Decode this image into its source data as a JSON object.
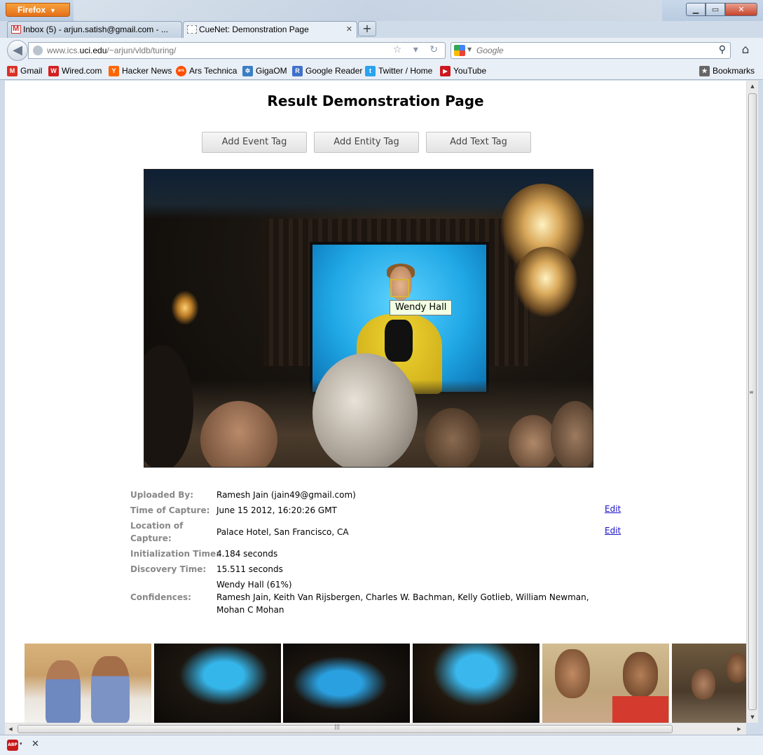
{
  "window": {
    "firefox_button_label": "Firefox",
    "min_glyph": "▁",
    "max_glyph": "▭",
    "close_glyph": "✕"
  },
  "tabs": [
    {
      "label": "Inbox (5) - arjun.satish@gmail.com - ...",
      "icon": "gmail-icon",
      "active": false
    },
    {
      "label": "CueNet: Demonstration Page",
      "icon": "blank-page-icon",
      "active": true
    }
  ],
  "newtab_glyph": "+",
  "navbar": {
    "back_glyph": "◀",
    "url_prefix": "www.ics.",
    "url_domain": "uci.edu",
    "url_suffix": "/~arjun/vldb/turing/",
    "url_buttons": "☆ ▾ ↻",
    "search_placeholder": "Google",
    "search_glyph": "⚲",
    "home_glyph": "⌂"
  },
  "bookmarks": [
    {
      "label": "Gmail",
      "icon": "gmail-icon",
      "color": "#d93025",
      "glyph": "M"
    },
    {
      "label": "Wired.com",
      "icon": "wired-icon",
      "color": "#d32020",
      "glyph": "W"
    },
    {
      "label": "Hacker News",
      "icon": "hacker-news-icon",
      "color": "#ff6600",
      "glyph": "Y"
    },
    {
      "label": "Ars Technica",
      "icon": "ars-technica-icon",
      "color": "#ff4e00",
      "glyph": "ars"
    },
    {
      "label": "GigaOM",
      "icon": "gigaom-icon",
      "color": "#3b7dc4",
      "glyph": "✲"
    },
    {
      "label": "Google Reader",
      "icon": "google-reader-icon",
      "color": "#3f71c9",
      "glyph": "R"
    },
    {
      "label": "Twitter / Home",
      "icon": "twitter-icon",
      "color": "#2aa3ef",
      "glyph": "t"
    },
    {
      "label": "YouTube",
      "icon": "youtube-icon",
      "color": "#cc181e",
      "glyph": "▶"
    }
  ],
  "bookmarks_menu": {
    "label": "Bookmarks",
    "glyph": "★"
  },
  "page": {
    "title": "Result Demonstration Page",
    "buttons": {
      "event": "Add Event Tag",
      "entity": "Add Entity Tag",
      "text": "Add Text Tag"
    },
    "face_label": "Wendy Hall",
    "info": {
      "uploaded_by": {
        "label": "Uploaded By:",
        "value": "Ramesh Jain (jain49@gmail.com)"
      },
      "time_of_capture": {
        "label": "Time of Capture:",
        "value": "June 15 2012, 16:20:26 GMT",
        "edit": "Edit"
      },
      "location_of_capture": {
        "label": "Location of Capture:",
        "value": "Palace Hotel, San Francisco, CA",
        "edit": "Edit"
      },
      "initialization_time": {
        "label": "Initialization Time:",
        "value": "4.184 seconds"
      },
      "discovery_time": {
        "label": "Discovery Time:",
        "value": "15.511 seconds"
      },
      "confidences": {
        "label": "Confidences:",
        "line1": "Wendy Hall (61%)",
        "line2": "Ramesh Jain, Keith Van Rijsbergen, Charles W. Bachman, Kelly Gotlieb, William Newman,",
        "line3": "Mohan C Mohan"
      }
    }
  },
  "scrollbars": {
    "up": "▲",
    "down": "▼",
    "left": "◀",
    "right": "▶",
    "grip_v": "≡",
    "grip_h": "|||"
  },
  "statusbar": {
    "abp_label": "ABP",
    "caret": "▾",
    "close": "✕"
  }
}
